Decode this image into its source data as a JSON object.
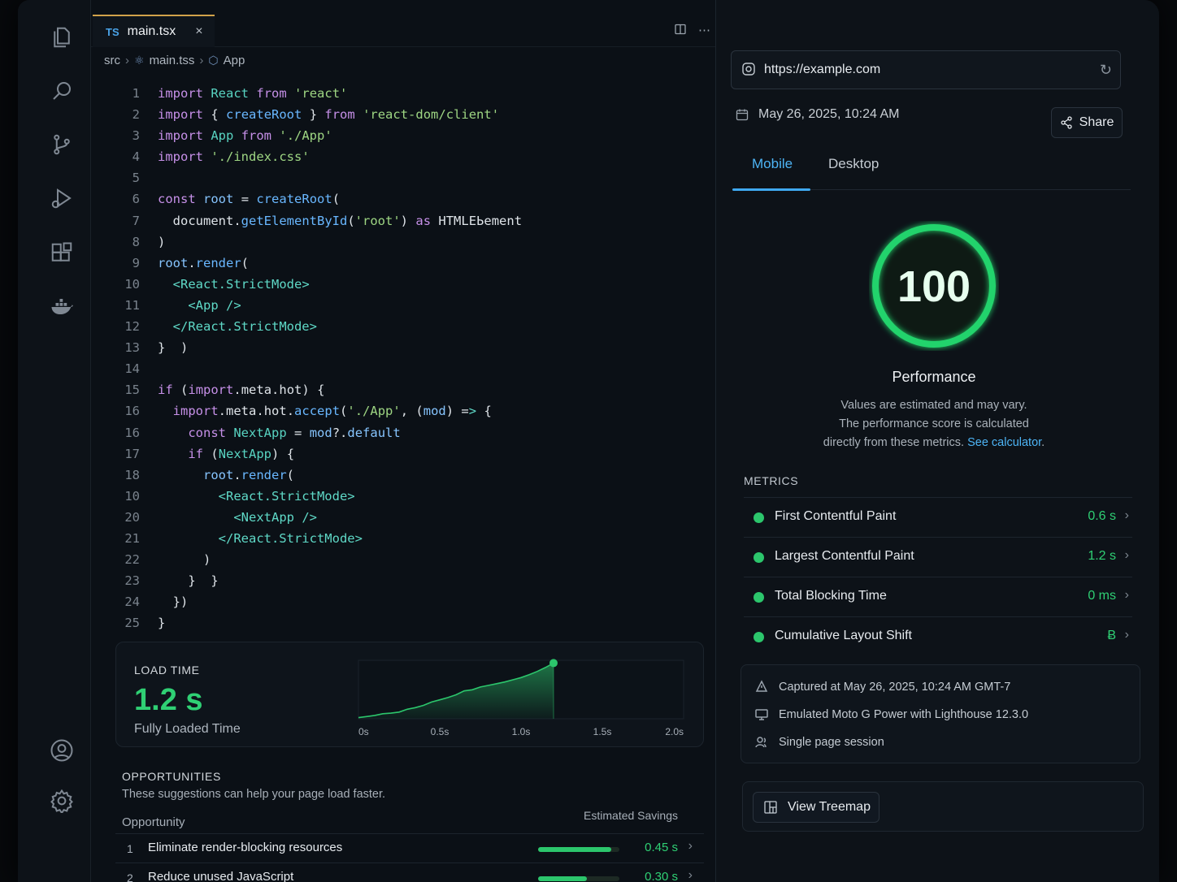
{
  "editor": {
    "tab": {
      "lang": "TS",
      "filename": "main.tsx",
      "close": "×"
    },
    "breadcrumb": {
      "folder": "src",
      "file": "main.tss",
      "component": "App"
    },
    "code": [
      {
        "n": "1"
      },
      {
        "n": "2"
      },
      {
        "n": "3"
      },
      {
        "n": "4"
      },
      {
        "n": "5"
      },
      {
        "n": "6"
      },
      {
        "n": "7"
      },
      {
        "n": "8"
      },
      {
        "n": "9"
      },
      {
        "n": "10"
      },
      {
        "n": "11"
      },
      {
        "n": "12"
      },
      {
        "n": "13"
      },
      {
        "n": "14"
      },
      {
        "n": "15"
      },
      {
        "n": "16"
      },
      {
        "n": "16"
      },
      {
        "n": "17"
      },
      {
        "n": "18"
      },
      {
        "n": "10"
      },
      {
        "n": "20"
      },
      {
        "n": "21"
      },
      {
        "n": "22"
      },
      {
        "n": "23"
      },
      {
        "n": "24"
      },
      {
        "n": "25"
      }
    ],
    "code_text": [
      "import React from 'react'",
      "import { createRoot } from 'react-dom/client'",
      "import App from './App'",
      "import './index.css'",
      "",
      "const root = createRoot(",
      "  document.getElementById('root') as HTMLEЬement",
      ")",
      "root.render(",
      "  <React.StrictMode>",
      "    <App />",
      "  </React.StrictMode>",
      "}  )",
      "",
      "if (import.meta.hot) {",
      "  import.meta.hot.accept('./App', (mod) => {",
      "    const NextApp = mod?.default",
      "    if (NextApp) {",
      "      root.render(",
      "        <React.StrictMode>",
      "          <NextApp />",
      "        </React.StrictMode>",
      "      )",
      "    }  }",
      "  })",
      "}"
    ]
  },
  "load_card": {
    "label": "LOAD TIME",
    "value": "1.2 s",
    "sub": "Fully Loaded Time",
    "x_ticks": [
      "0s",
      "0.5s",
      "1.0s",
      "1.5s",
      "2.0s"
    ]
  },
  "chart_data": {
    "type": "area",
    "x": [
      0,
      0.05,
      0.1,
      0.15,
      0.2,
      0.25,
      0.3,
      0.35,
      0.4,
      0.45,
      0.5,
      0.55,
      0.6,
      0.65,
      0.7,
      0.75,
      0.8,
      0.85,
      0.9,
      0.95,
      1.0,
      1.05,
      1.1,
      1.15,
      1.2
    ],
    "y": [
      0.02,
      0.04,
      0.06,
      0.09,
      0.1,
      0.12,
      0.17,
      0.2,
      0.24,
      0.3,
      0.34,
      0.38,
      0.43,
      0.5,
      0.52,
      0.57,
      0.6,
      0.63,
      0.66,
      0.7,
      0.74,
      0.79,
      0.85,
      0.92,
      1.0
    ],
    "xlim": [
      0,
      2.0
    ],
    "ylim": [
      0,
      1.05
    ],
    "xlabel": "",
    "ylabel": "",
    "grid": false,
    "color": "#2cc66c"
  },
  "opportunities": {
    "title": "OPPORTUNITIES",
    "desc": "These suggestions can help your page load faster.",
    "col_opportunity": "Opportunity",
    "col_savings": "Estimated Savings",
    "rows": [
      {
        "n": "1",
        "label": "Eliminate render-blocking resources",
        "value": "0.45 s",
        "fraction": 0.9
      },
      {
        "n": "2",
        "label": "Reduce unused JavaScript",
        "value": "0.30 s",
        "fraction": 0.6
      }
    ]
  },
  "panel": {
    "url": "https://example.com",
    "datetime": "May 26, 2025, 10:24 AM",
    "share": "Share",
    "tabs": [
      "Mobile",
      "Desktop"
    ],
    "score": "100",
    "score_fraction": 1.0,
    "perf_title": "Performance",
    "perf_desc_1": "Values are estimated and may vary.",
    "perf_desc_2": "The performance score is calculated",
    "perf_desc_3": "directly from these metrics.",
    "perf_link": "See calculator",
    "perf_end": ".",
    "metrics_title": "METRICS",
    "metrics": [
      {
        "name": "First Contentful Paint",
        "value": "0.6 s"
      },
      {
        "name": "Largest Contentful Paint",
        "value": "1.2 s"
      },
      {
        "name": "Total Blocking Time",
        "value": "0 ms"
      },
      {
        "name": "Cumulative Layout Shift",
        "value": "Ƀ"
      }
    ],
    "captured": "Captured at May 26, 2025, 10:24 AM GMT-7",
    "emulated": "Emulated Moto G Power with Lighthouse 12.3.0",
    "session": "Single page session",
    "treemap": "View Treemap",
    "accent": "#3fa9f0",
    "good": "#2cc66c"
  }
}
